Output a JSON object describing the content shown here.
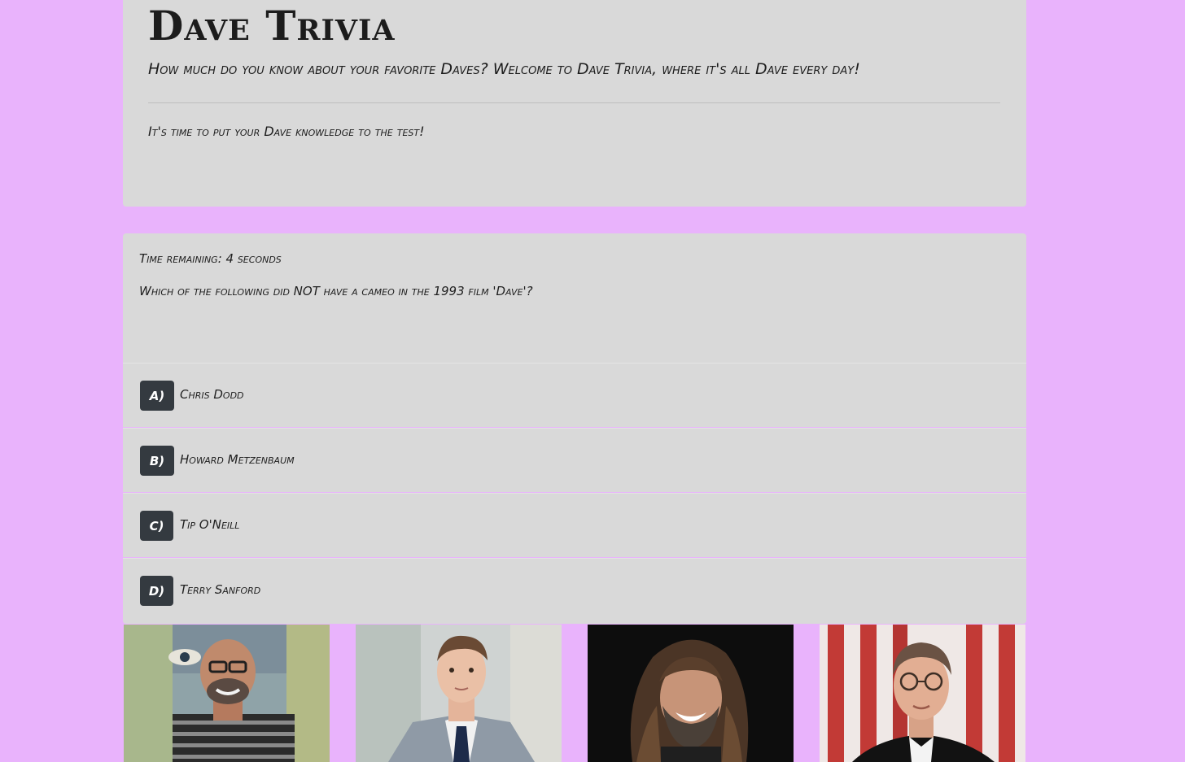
{
  "header": {
    "title": "Dave Trivia",
    "lead": "How much do you know about your favorite Daves? Welcome to Dave Trivia, where it's all Dave every day!",
    "sublead": "It's time to put your Dave knowledge to the test!"
  },
  "quiz": {
    "timer": "Time remaining: 4 seconds",
    "question": "Which of the following did NOT have a cameo in the 1993 film 'Dave'?",
    "answers": [
      {
        "letter": "A)",
        "text": "Chris Dodd"
      },
      {
        "letter": "B)",
        "text": "Howard Metzenbaum"
      },
      {
        "letter": "C)",
        "text": "Tip O'Neill"
      },
      {
        "letter": "D)",
        "text": "Terry Sanford"
      }
    ]
  },
  "gallery": {
    "images": [
      {
        "icon": "photo-dave-bald-glasses"
      },
      {
        "icon": "photo-dave-young-suit"
      },
      {
        "icon": "photo-dave-long-hair"
      },
      {
        "icon": "photo-dave-flag-glasses"
      }
    ]
  },
  "colors": {
    "background": "#e9b3fc",
    "card": "#d9d9d9",
    "badge": "#343a40"
  }
}
